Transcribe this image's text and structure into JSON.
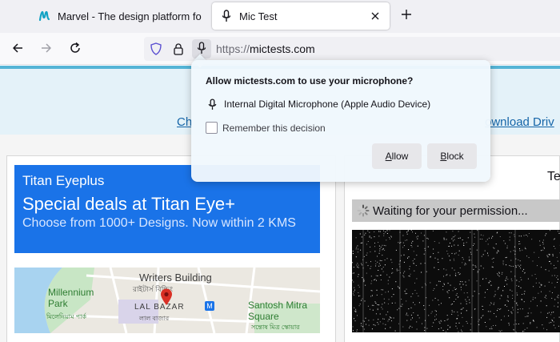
{
  "browser": {
    "tabs": [
      {
        "title": "Marvel - The design platform fo",
        "icon": "marvel-logo-icon",
        "active": false
      },
      {
        "title": "Mic Test",
        "icon": "microphone-icon",
        "active": true
      }
    ],
    "new_tab_icon": "plus-icon",
    "url": {
      "scheme": "https://",
      "host": "mictests.com"
    },
    "nav_icons": [
      "back-arrow-icon",
      "forward-arrow-icon",
      "reload-icon",
      "shield-icon",
      "lock-icon",
      "microphone-icon"
    ]
  },
  "permission_popup": {
    "question": "Allow mictests.com to use your microphone?",
    "device": "Internal Digital Microphone (Apple Audio Device)",
    "remember_label": "Remember this decision",
    "remember_checked": false,
    "allow_first": "A",
    "allow_rest": "llow",
    "block_first": "B",
    "block_rest": "lock"
  },
  "page": {
    "link_left": "Ch",
    "link_right": "ownload Driv",
    "ad": {
      "brand": "Titan Eyeplus",
      "headline": "Special deals at Titan Eye+",
      "subtext": "Choose from 1000+ Designs. Now within 2 KMS",
      "map_labels": {
        "writers": "Writers Building",
        "writers_local": "রাইটার্স বিল্ডিং",
        "park": "Millennium Park",
        "park_local": "মিলেনিয়াম পার্ক",
        "lalbazar": "LAL BAZAR",
        "lalbazar_local": "লাল বাজার",
        "santosh": "Santosh Mitra Square",
        "santosh_local": "সন্তোষ মিত্র স্কোয়ার",
        "metro": "M"
      }
    },
    "test_title": "Te",
    "waiting_text": "Waiting for your permission..."
  },
  "colors": {
    "ad_blue": "#1a73e8",
    "band": "#e4f2f9",
    "link": "#1565a8"
  }
}
